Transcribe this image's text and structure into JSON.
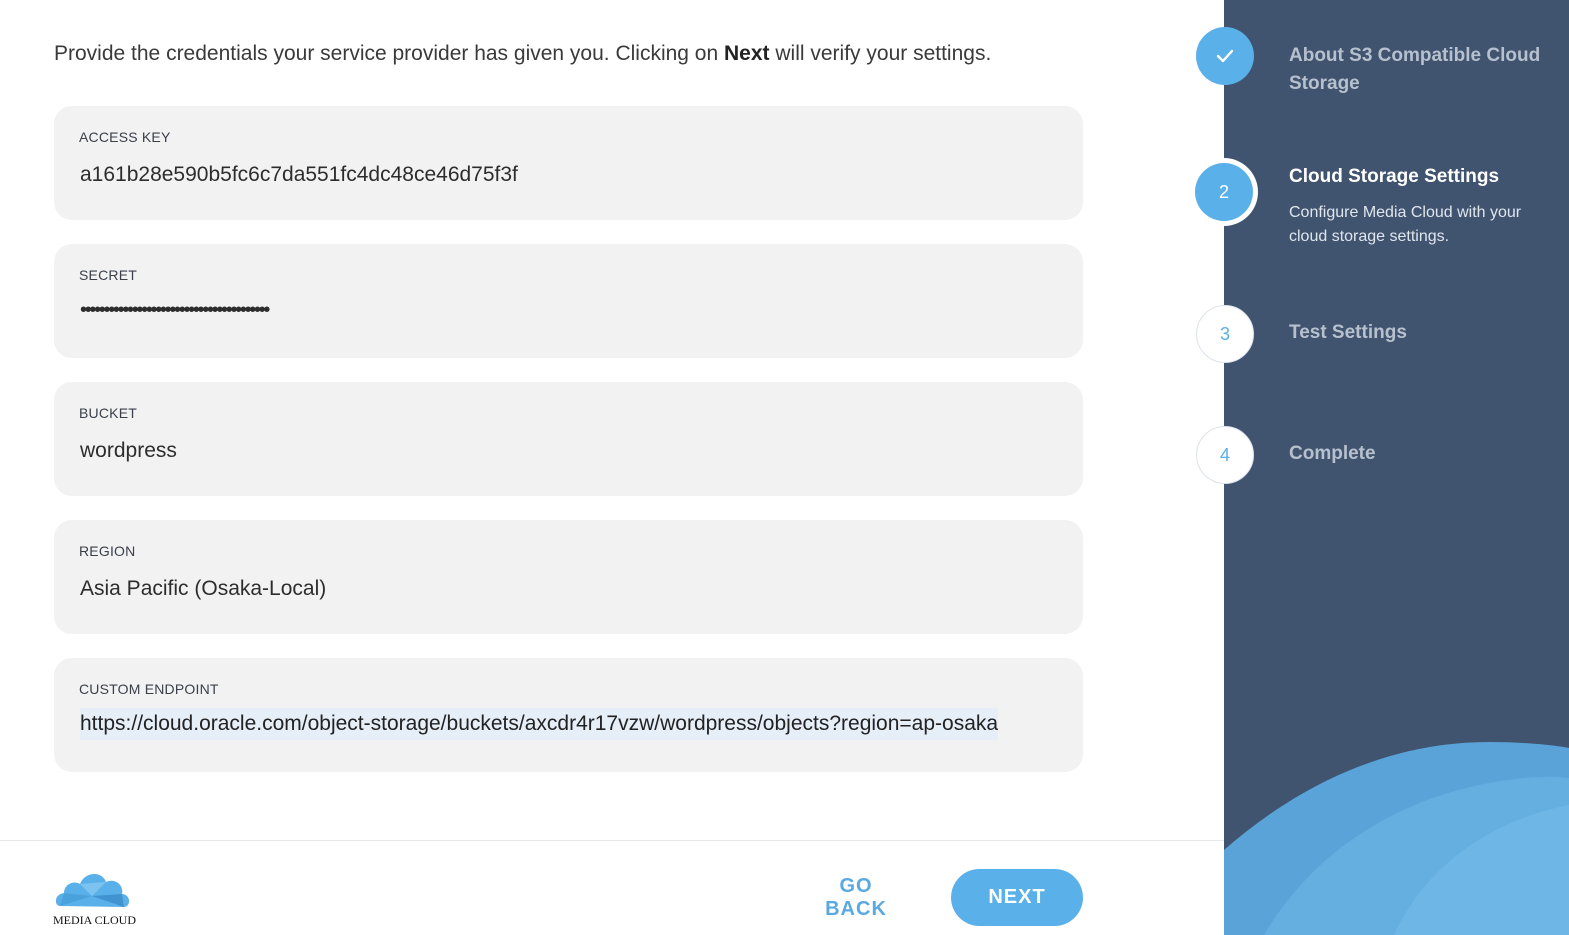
{
  "intro": {
    "prefix": "Provide the credentials your service provider has given you. Clicking on ",
    "bold": "Next",
    "suffix": " will verify your settings."
  },
  "fields": {
    "access_key": {
      "label": "ACCESS KEY",
      "value": "a161b28e590b5fc6c7da551fc4dc48ce46d75f3f"
    },
    "secret": {
      "label": "SECRET",
      "value": "••••••••••••••••••••••••••••••••••••••••"
    },
    "bucket": {
      "label": "BUCKET",
      "value": "wordpress"
    },
    "region": {
      "label": "REGION",
      "value": "Asia Pacific (Osaka-Local)"
    },
    "custom_endpoint": {
      "label": "CUSTOM ENDPOINT",
      "value": "https://cloud.oracle.com/object-storage/buckets/axcdr4r17vzw/wordpress/objects?region=ap-osaka"
    }
  },
  "footer": {
    "logo_text": "MEDIA CLOUD",
    "go_back_label": "GO BACK",
    "next_label": "NEXT"
  },
  "steps": [
    {
      "marker": "check-icon",
      "title": "About S3 Compatible Cloud Storage",
      "state": "done"
    },
    {
      "marker": "2",
      "title": "Cloud Storage Settings",
      "description": "Configure Media Cloud with your cloud storage settings.",
      "state": "active"
    },
    {
      "marker": "3",
      "title": "Test Settings",
      "state": "pending"
    },
    {
      "marker": "4",
      "title": "Complete",
      "state": "pending"
    }
  ],
  "colors": {
    "accent": "#5ab0e8",
    "sidebar": "#40536f",
    "field_bg": "#f2f2f2"
  }
}
